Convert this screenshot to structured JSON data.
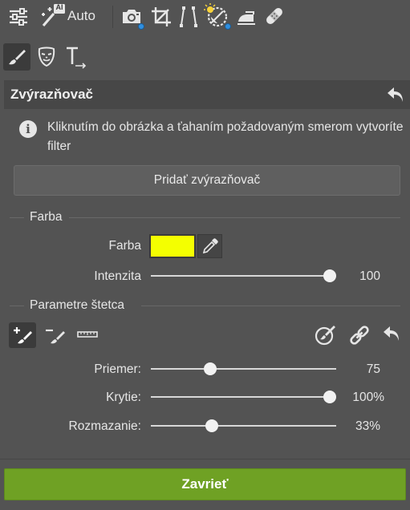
{
  "toolbar": {
    "ai_badge": "AI",
    "auto_label": "Auto"
  },
  "panel": {
    "title": "Zvýrazňovač"
  },
  "info": {
    "text": "Kliknutím do obrázka a ťahaním požadovaným smerom vytvoríte filter"
  },
  "add_button": "Pridať zvýrazňovač",
  "color_section": {
    "title": "Farba",
    "color_label": "Farba",
    "color_value": "#f4ff00",
    "intensity_label": "Intenzita",
    "intensity_value": "100",
    "intensity_fraction": 1.0
  },
  "brush_section": {
    "title": "Parametre štetca",
    "diameter_label": "Priemer:",
    "diameter_value": "75",
    "diameter_fraction": 0.32,
    "opacity_label": "Krytie:",
    "opacity_value": "100%",
    "opacity_fraction": 1.0,
    "blur_label": "Rozmazanie:",
    "blur_value": "33%",
    "blur_fraction": 0.33
  },
  "close_button": "Zavrieť",
  "icons": [
    "sliders-icon",
    "magic-wand-icon",
    "camera-icon",
    "crop-icon",
    "perspective-icon",
    "exposure-icon",
    "iron-icon",
    "bandage-icon",
    "brush-icon",
    "mask-icon",
    "text-icon",
    "undo-icon",
    "info-icon",
    "eyedropper-icon",
    "brush-add-icon",
    "brush-erase-icon",
    "ruler-icon",
    "brush-settings-icon",
    "link-icon"
  ]
}
